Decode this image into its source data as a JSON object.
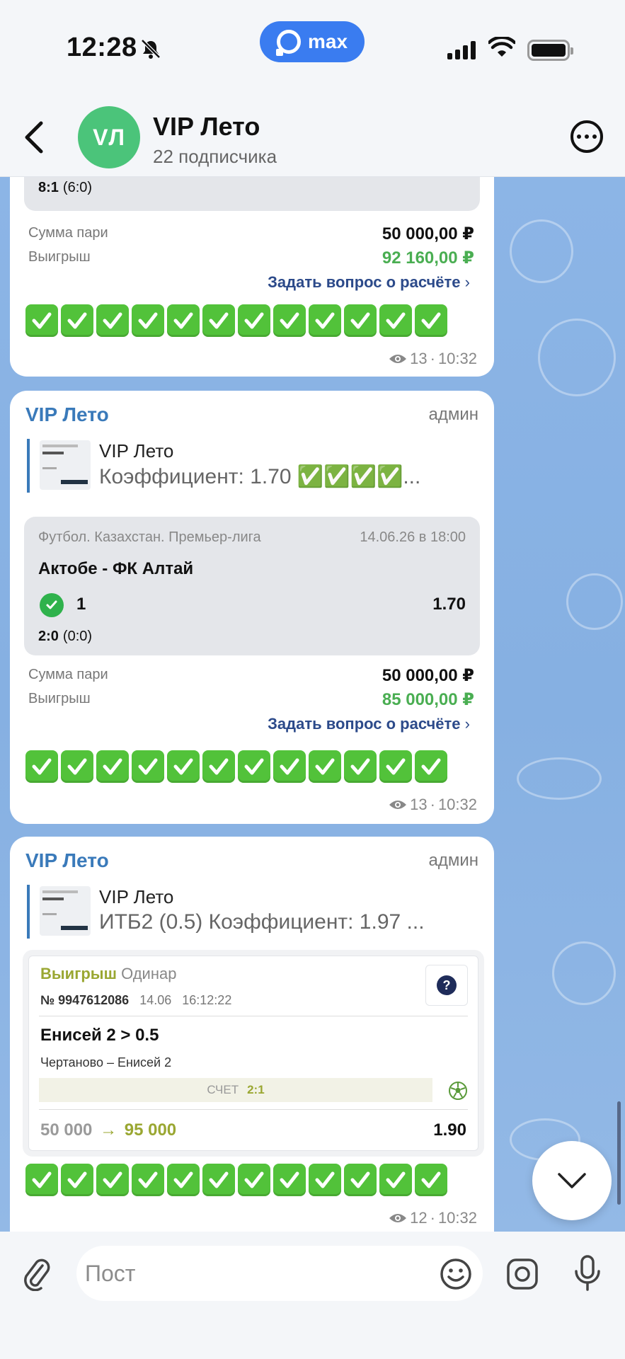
{
  "status_bar": {
    "time": "12:28",
    "app_pill": "max"
  },
  "header": {
    "avatar_initials": "VЛ",
    "title": "VIP Лето",
    "subtitle": "22 подписчика"
  },
  "messages": [
    {
      "score": "8:1",
      "score_half": "(6:0)",
      "stake_label": "Сумма пари",
      "stake_value": "50 000,00 ₽",
      "win_label": "Выигрыш",
      "win_value": "92 160,00 ₽",
      "ask": "Задать вопрос о расчёте",
      "views": "13",
      "time": "10:32"
    },
    {
      "sender": "VIP Лето",
      "role": "админ",
      "quote_title": "VIP Лето",
      "quote_text": "Коэффициент: 1.70 ✅✅✅✅...",
      "league": "Футбол. Казахстан. Премьер-лига",
      "date": "14.06.26 в 18:00",
      "match": "Актобе - ФК Алтай",
      "pick": "1",
      "odds": "1.70",
      "score": "2:0",
      "score_half": "(0:0)",
      "stake_label": "Сумма пари",
      "stake_value": "50 000,00 ₽",
      "win_label": "Выигрыш",
      "win_value": "85 000,00 ₽",
      "ask": "Задать вопрос о расчёте",
      "views": "13",
      "time": "10:32"
    },
    {
      "sender": "VIP Лето",
      "role": "админ",
      "quote_title": "VIP Лето",
      "quote_text": "ИТБ2 (0.5) Коэффициент: 1.97 ...",
      "ticket": {
        "status": "Выигрыш",
        "type": "Одинар",
        "number": "№ 9947612086",
        "date": "14.06",
        "clock": "16:12:22",
        "pick": "Енисей 2 > 0.5",
        "match": "Чертаново – Енисей 2",
        "score_label": "СЧЕТ",
        "score": "2:1",
        "stake": "50 000",
        "arrow": "→",
        "payout": "95 000",
        "odds": "1.90"
      },
      "views": "12",
      "time": "10:32"
    }
  ],
  "composer": {
    "placeholder": "Пост"
  },
  "colors": {
    "accent": "#3a7aba",
    "win_green": "#4aae52",
    "check_green": "#52c23a",
    "avatar": "#4bc47a"
  }
}
